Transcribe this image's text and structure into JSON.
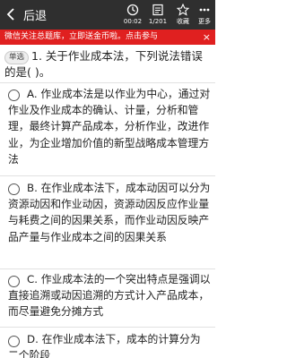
{
  "header": {
    "back_label": "后退",
    "timer": "00:02",
    "page": "1/201",
    "favorite_label": "收藏",
    "more_label": "更多"
  },
  "banner": {
    "text": "微信关注总题库，立即送金币啦。点击参与",
    "close": "×"
  },
  "question": {
    "type_label": "单选",
    "text": "1. 关于作业成本法，下列说法错误的是( )。"
  },
  "options": [
    {
      "text": "A. 作业成本法是以作业为中心，通过对作业及作业成本的确认、计量，分析和管理，最终计算产品成本，分析作业，改进作业，为企业增加价值的新型战略成本管理方法"
    },
    {
      "text": "B. 在作业成本法下，成本动因可以分为资源动因和作业动因，资源动因反应作业量与耗费之间的因果关系，而作业动因反映产品产量与作业成本之间的因果关系"
    },
    {
      "text": "C. 作业成本法的一个突出特点是强调以直接追溯或动因追溯的方式计入产品成本，而尽量避免分摊方式"
    },
    {
      "text": "D. 在作业成本法下，成本的计算分为二个阶段"
    }
  ],
  "colors": {
    "topbar": "#2f2f2f",
    "banner": "#e02020",
    "divider": "#e1e1e1"
  }
}
